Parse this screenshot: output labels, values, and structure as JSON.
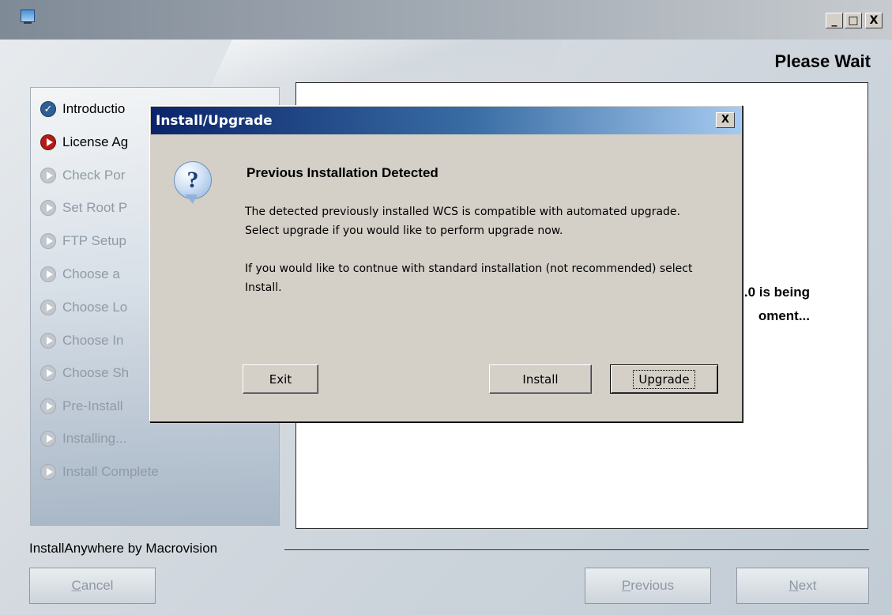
{
  "page": {
    "header_title": "Please Wait",
    "caption_buttons": [
      "_",
      "□",
      "X"
    ]
  },
  "steps": [
    {
      "label": "Introductio",
      "state": "done"
    },
    {
      "label": "License Ag",
      "state": "current"
    },
    {
      "label": "Check Por",
      "state": "todo"
    },
    {
      "label": "Set Root P",
      "state": "todo"
    },
    {
      "label": "FTP Setup",
      "state": "todo"
    },
    {
      "label": "Choose a",
      "state": "todo"
    },
    {
      "label": "Choose Lo",
      "state": "todo"
    },
    {
      "label": "Choose In",
      "state": "todo"
    },
    {
      "label": "Choose Sh",
      "state": "todo"
    },
    {
      "label": "Pre-Install",
      "state": "todo"
    },
    {
      "label": "Installing...",
      "state": "todo"
    },
    {
      "label": "Install Complete",
      "state": "todo"
    }
  ],
  "message": {
    "line1": ".0 is being",
    "line2": "oment..."
  },
  "footer": {
    "brand": "InstallAnywhere by Macrovision",
    "cancel": "Cancel",
    "previous": "Previous",
    "next": "Next"
  },
  "dialog": {
    "title": "Install/Upgrade",
    "close": "X",
    "icon": "question-icon",
    "heading": "Previous Installation Detected",
    "paragraph1": "The detected previously installed WCS is compatible with automated upgrade.  Select upgrade if you would like to perform upgrade now.",
    "paragraph2": "If you would like to contnue with standard installation (not recommended) select Install.",
    "buttons": {
      "exit": "Exit",
      "install": "Install",
      "upgrade": "Upgrade"
    }
  },
  "colors": {
    "dialog_title_start": "#0a246a",
    "dialog_title_end": "#a6caf0",
    "step_done": "#2f5f95",
    "step_current": "#b41b17",
    "step_todo": "#c1c7cd"
  }
}
